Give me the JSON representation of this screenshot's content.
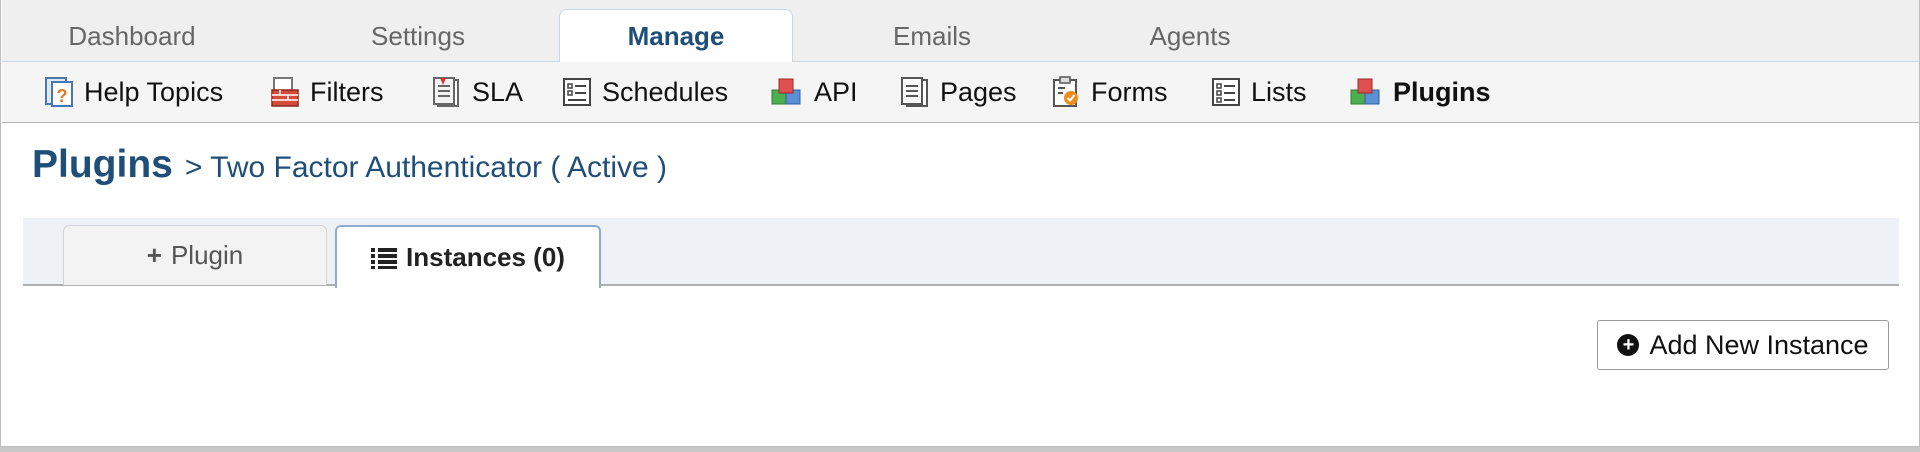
{
  "main_nav": {
    "tabs": [
      {
        "label": "Dashboard"
      },
      {
        "label": "Settings"
      },
      {
        "label": "Manage"
      },
      {
        "label": "Emails"
      },
      {
        "label": "Agents"
      }
    ],
    "active": "Manage"
  },
  "sub_nav": {
    "items": [
      {
        "label": "Help Topics",
        "icon": "help-topics-icon"
      },
      {
        "label": "Filters",
        "icon": "filters-icon"
      },
      {
        "label": "SLA",
        "icon": "sla-icon"
      },
      {
        "label": "Schedules",
        "icon": "schedules-icon"
      },
      {
        "label": "API",
        "icon": "api-cubes-icon"
      },
      {
        "label": "Pages",
        "icon": "pages-icon"
      },
      {
        "label": "Forms",
        "icon": "forms-clipboard-icon"
      },
      {
        "label": "Lists",
        "icon": "lists-icon"
      },
      {
        "label": "Plugins",
        "icon": "plugins-cubes-icon"
      }
    ],
    "active": "Plugins"
  },
  "page": {
    "title": "Plugins",
    "breadcrumb": "> Two Factor Authenticator ( Active )"
  },
  "tabs": {
    "plugin_label": "Plugin",
    "instances_label": "Instances (0)",
    "active": "Instances (0)"
  },
  "actions": {
    "add_instance_label": "Add New Instance"
  },
  "colors": {
    "accent": "#1f4e79",
    "tab_border_active": "#8faad1",
    "nav_bg": "#efefef"
  }
}
